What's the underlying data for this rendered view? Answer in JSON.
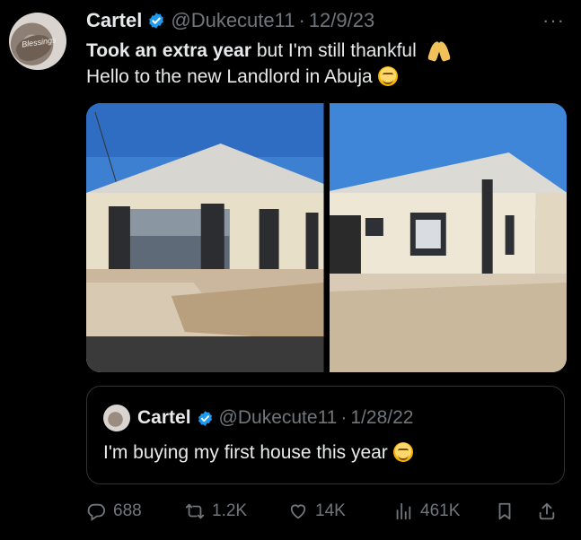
{
  "tweet": {
    "author_name": "Cartel",
    "handle": "@Dukecute11",
    "separator": "·",
    "date": "12/9/23",
    "more_label": "···",
    "text_bold": "Took an extra year",
    "text_line1_rest": " but I'm still thankful",
    "text_line2": "Hello to the new Landlord in Abuja"
  },
  "quoted": {
    "author_name": "Cartel",
    "handle": "@Dukecute11",
    "separator": "·",
    "date": "1/28/22",
    "text": "I'm buying my first house this year"
  },
  "metrics": {
    "replies": "688",
    "retweets": "1.2K",
    "likes": "14K",
    "views": "461K"
  },
  "colors": {
    "background": "#000000",
    "text": "#e7e9ea",
    "secondary": "#71767b",
    "verified": "#1d9bf0",
    "border": "#2f3336"
  },
  "icons": [
    "verified-badge-icon",
    "more-icon",
    "reply-icon",
    "retweet-icon",
    "like-icon",
    "views-icon",
    "bookmark-icon",
    "share-icon"
  ]
}
